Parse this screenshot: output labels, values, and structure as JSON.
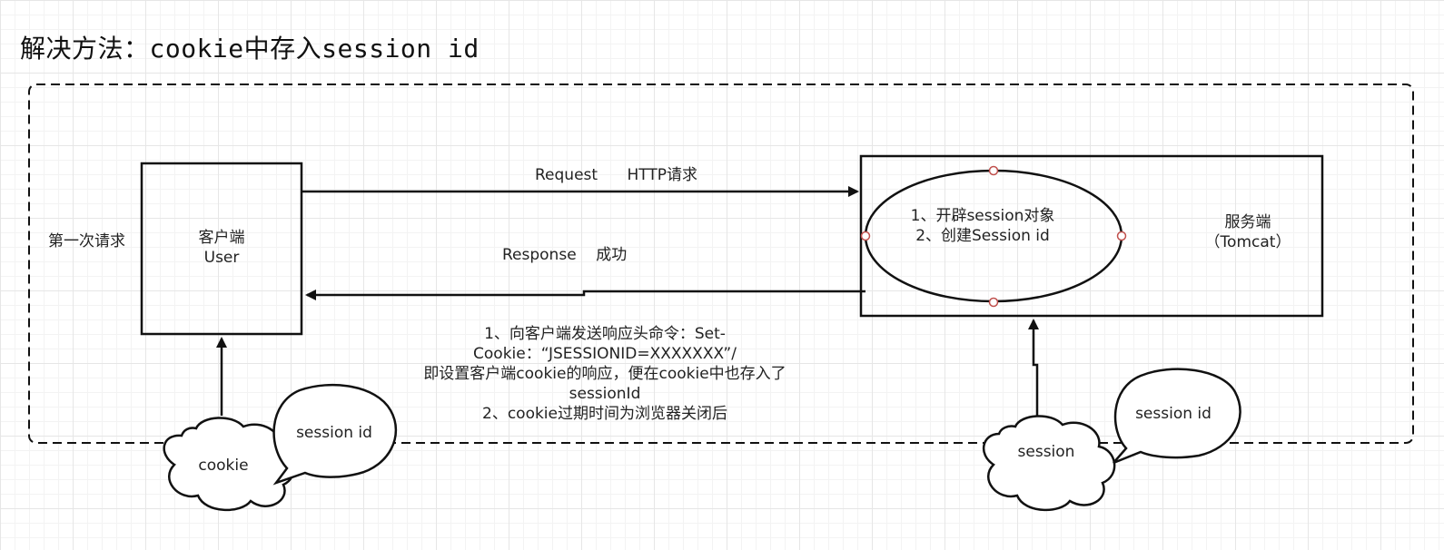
{
  "title": "解决方法：cookie中存入session id",
  "client": {
    "label_line1": "客户端",
    "label_line2": "User",
    "side_label": "第一次请求"
  },
  "server": {
    "label_line1": "服务端",
    "label_line2": "（Tomcat）",
    "ellipse_line1": "1、开辟session对象",
    "ellipse_line2": "2、创建Session id"
  },
  "request_arrow": {
    "label": "Request      HTTP请求"
  },
  "response_arrow": {
    "label": "Response    成功"
  },
  "response_note": {
    "line1": "1、向客户端发送响应头命令：Set-",
    "line2": "Cookie：“JSESSIONID=XXXXXXX”/",
    "line3": "即设置客户端cookie的响应，便在cookie中也存入了",
    "line4": "sessionId",
    "line5": "2、cookie过期时间为浏览器关闭后"
  },
  "client_cloud": {
    "label": "cookie"
  },
  "client_bubble": {
    "label": "session id"
  },
  "server_cloud": {
    "label": "session"
  },
  "server_bubble": {
    "label": "session id"
  },
  "colors": {
    "stroke": "#111111",
    "handle": "#c0504d",
    "grid": "#e6e6e6"
  }
}
